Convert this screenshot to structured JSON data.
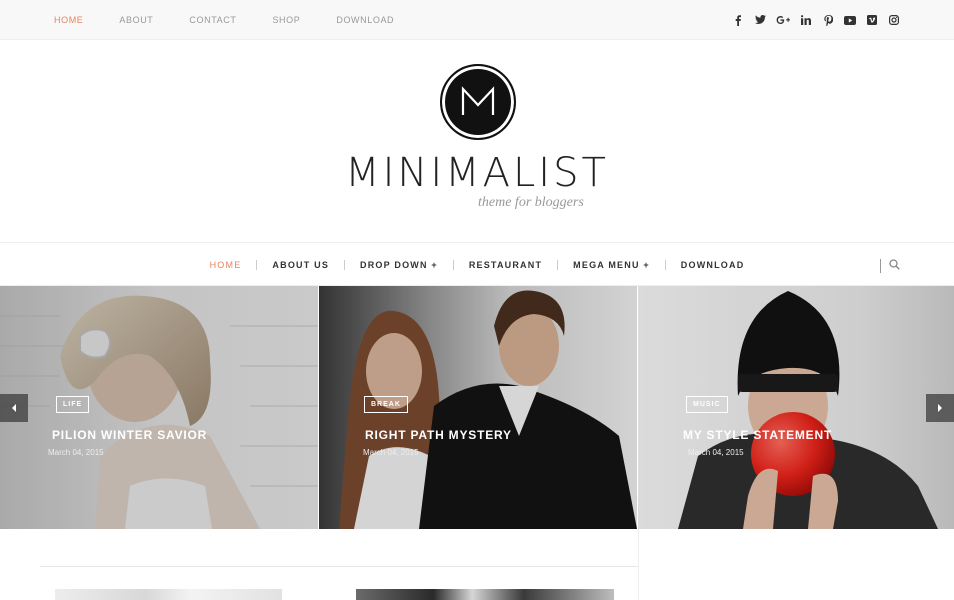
{
  "topnav": [
    "HOME",
    "ABOUT",
    "CONTACT",
    "SHOP",
    "DOWNLOAD"
  ],
  "social_icons": [
    "facebook-icon",
    "twitter-icon",
    "google-plus-icon",
    "linkedin-icon",
    "pinterest-icon",
    "youtube-icon",
    "vimeo-icon",
    "instagram-icon"
  ],
  "logo": {
    "title": "MINIMALIST",
    "tagline": "theme for bloggers"
  },
  "mainnav": [
    "HOME",
    "ABOUT US",
    "DROP DOWN +",
    "RESTAURANT",
    "MEGA MENU +",
    "DOWNLOAD"
  ],
  "slides": [
    {
      "category": "Life",
      "title": "PILION WINTER SAVIOR",
      "date": "March 04, 2015"
    },
    {
      "category": "BREAK",
      "title": "RIGHT PATH MYSTERY",
      "date": "March 04, 2015"
    },
    {
      "category": "Music",
      "title": "MY STYLE STATEMENT",
      "date": "March 04, 2015"
    }
  ],
  "colors": {
    "accent": "#e8845c",
    "dark": "#111111"
  }
}
